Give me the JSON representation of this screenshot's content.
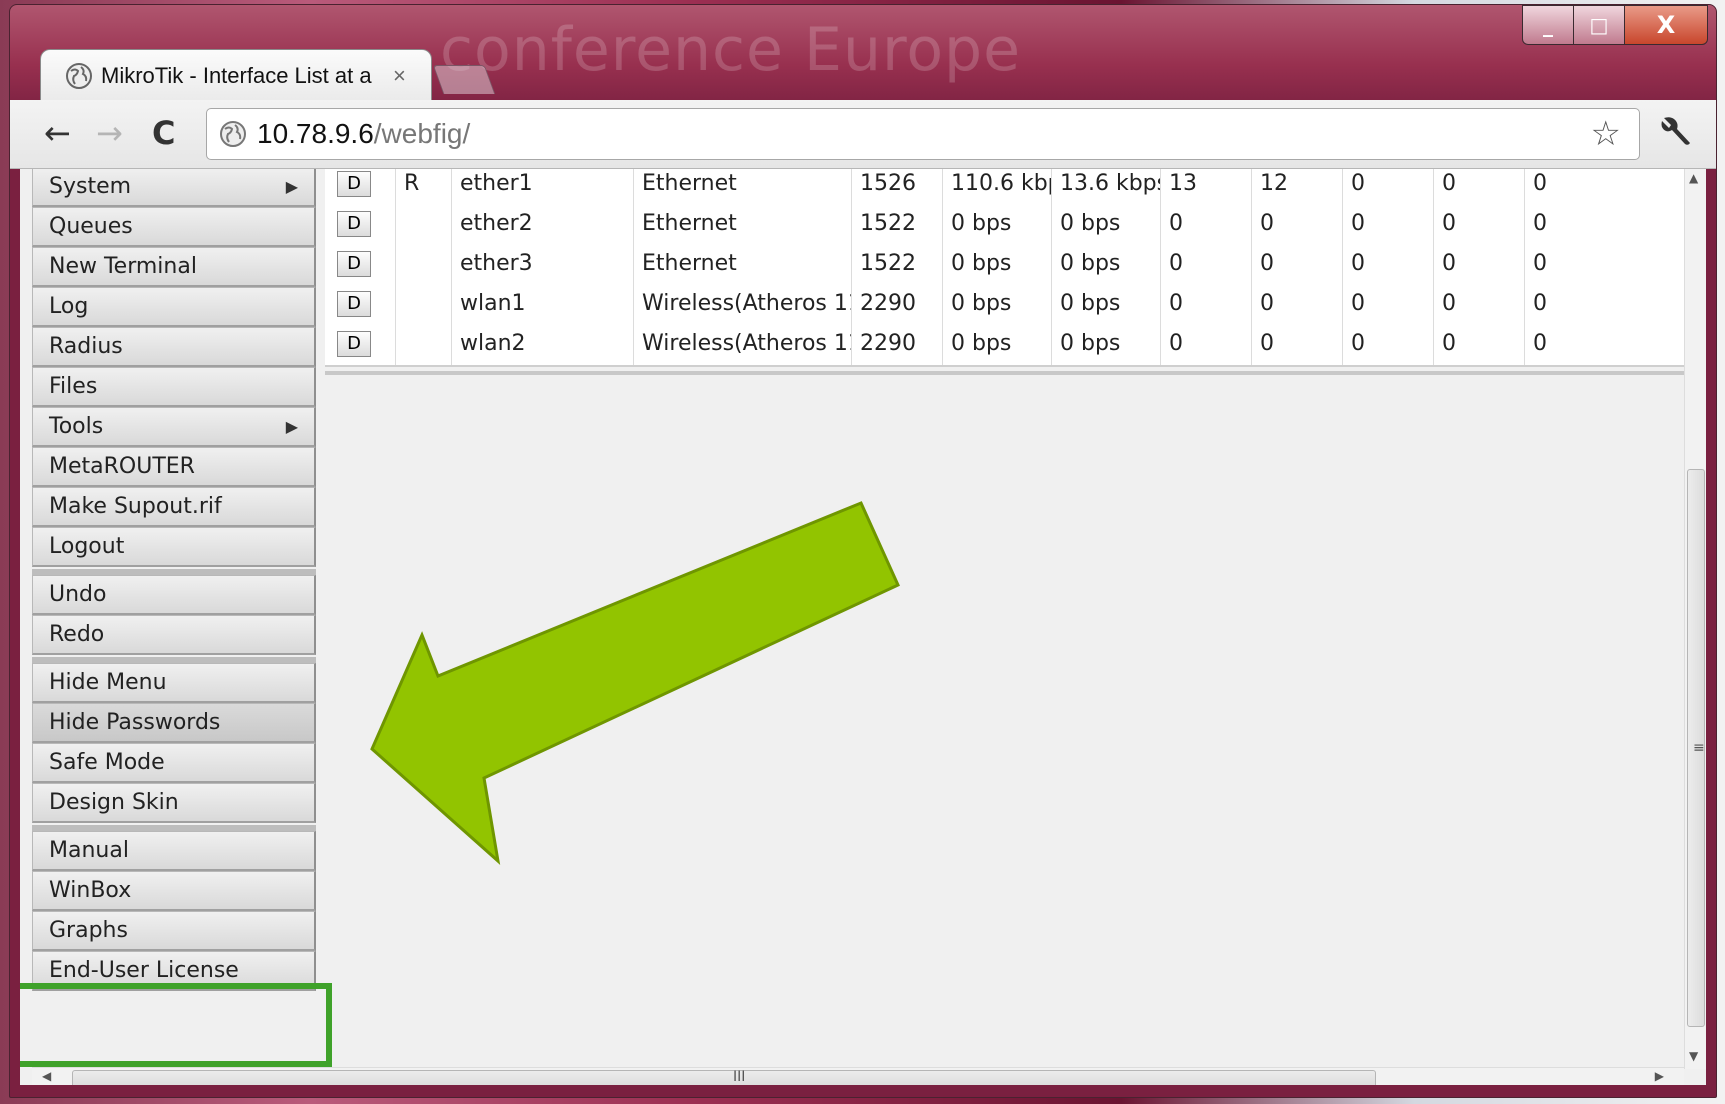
{
  "browser": {
    "tab_title": "MikroTik - Interface List at a",
    "tab_close": "×",
    "url_host": "10.78.9.6",
    "url_path": "/webfig/",
    "window_buttons": {
      "minimize": "_",
      "maximize": "□",
      "close": "X"
    },
    "titlebar_decoration_text": "conference Europe"
  },
  "sidebar": {
    "items": [
      {
        "label": "System",
        "submenu": true
      },
      {
        "label": "Queues"
      },
      {
        "label": "New Terminal"
      },
      {
        "label": "Log"
      },
      {
        "label": "Radius"
      },
      {
        "label": "Files"
      },
      {
        "label": "Tools",
        "submenu": true
      },
      {
        "label": "MetaROUTER"
      },
      {
        "label": "Make Supout.rif"
      },
      {
        "label": "Logout"
      },
      {
        "label": "Undo"
      },
      {
        "label": "Redo"
      },
      {
        "label": "Hide Menu"
      },
      {
        "label": "Hide Passwords"
      },
      {
        "label": "Safe Mode"
      },
      {
        "label": "Design Skin"
      },
      {
        "label": "Manual"
      },
      {
        "label": "WinBox"
      },
      {
        "label": "Graphs"
      },
      {
        "label": "End-User License"
      }
    ],
    "highlighted_item": "Design Skin"
  },
  "interfaces": {
    "rows": [
      {
        "d": "D",
        "flag": "R",
        "name": "ether1",
        "type": "Ethernet",
        "l2mtu": "1526",
        "tx": "110.6 kbp",
        "rx": "13.6 kbps",
        "tx_packets": "13",
        "rx_packets": "12",
        "c1": "0",
        "c2": "0",
        "c3": "0"
      },
      {
        "d": "D",
        "flag": "",
        "name": "ether2",
        "type": "Ethernet",
        "l2mtu": "1522",
        "tx": "0 bps",
        "rx": "0 bps",
        "tx_packets": "0",
        "rx_packets": "0",
        "c1": "0",
        "c2": "0",
        "c3": "0"
      },
      {
        "d": "D",
        "flag": "",
        "name": "ether3",
        "type": "Ethernet",
        "l2mtu": "1522",
        "tx": "0 bps",
        "rx": "0 bps",
        "tx_packets": "0",
        "rx_packets": "0",
        "c1": "0",
        "c2": "0",
        "c3": "0"
      },
      {
        "d": "D",
        "flag": "",
        "name": "wlan1",
        "type": "Wireless(Atheros 11",
        "l2mtu": "2290",
        "tx": "0 bps",
        "rx": "0 bps",
        "tx_packets": "0",
        "rx_packets": "0",
        "c1": "0",
        "c2": "0",
        "c3": "0"
      },
      {
        "d": "D",
        "flag": "",
        "name": "wlan2",
        "type": "Wireless(Atheros 11",
        "l2mtu": "2290",
        "tx": "0 bps",
        "rx": "0 bps",
        "tx_packets": "0",
        "rx_packets": "0",
        "c1": "0",
        "c2": "0",
        "c3": "0"
      }
    ]
  },
  "annotation": {
    "arrow_color": "#92c400",
    "arrow_outline": "#6f9600",
    "box_color": "#3fa22a"
  },
  "icons": {
    "back": "←",
    "forward": "→",
    "reload": "C",
    "star": "☆",
    "wrench": "wrench",
    "submenu_arrow": "▶",
    "scroll_up": "▲",
    "scroll_down": "▼",
    "scroll_left": "◀",
    "scroll_right": "▶",
    "v_grip": "≡",
    "h_grip": "III"
  }
}
